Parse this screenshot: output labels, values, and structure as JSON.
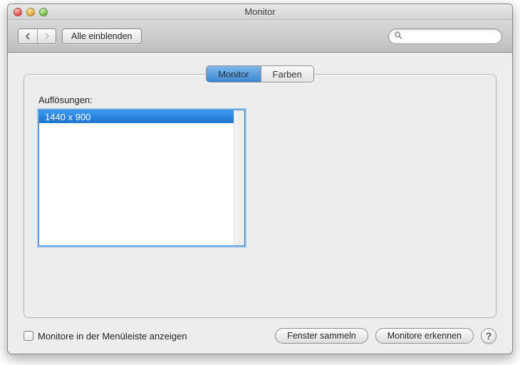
{
  "window": {
    "title": "Monitor"
  },
  "toolbar": {
    "show_all_label": "Alle einblenden",
    "search_placeholder": ""
  },
  "tabs": {
    "monitor": "Monitor",
    "colors": "Farben"
  },
  "main": {
    "resolutions_label": "Auflösungen:",
    "resolutions": [
      "1440 x 900"
    ]
  },
  "footer": {
    "show_in_menubar_label": "Monitore in der Menüleiste anzeigen",
    "gather_windows_label": "Fenster sammeln",
    "detect_displays_label": "Monitore erkennen",
    "help_label": "?"
  }
}
